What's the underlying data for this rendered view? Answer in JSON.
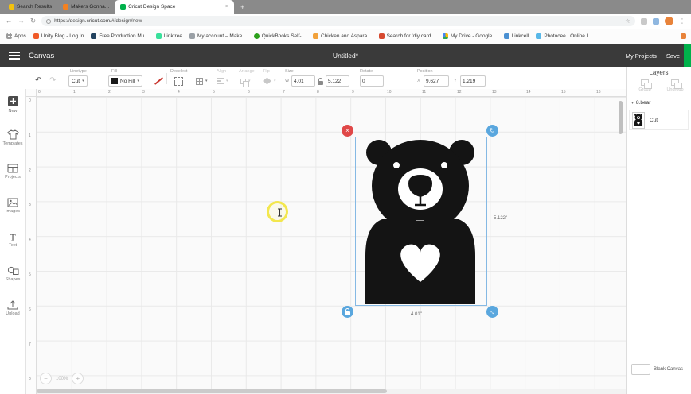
{
  "colors": {
    "cricut_green": "#00b14b",
    "selection_blue": "#5aa7de",
    "delete_handle_red": "#e04848",
    "highlight_yellow": "#f2e43c",
    "header_dark": "#3a3a3a"
  },
  "icons": {
    "back": "←",
    "forward": "→",
    "refresh": "↻",
    "star": "☆",
    "menu": "⋮",
    "close": "×",
    "caret": "▾",
    "undo": "↶",
    "redo": "↷",
    "rotate_handle": "↻",
    "resize_handle": "↔",
    "plus": "+",
    "minus": "−",
    "collapse": "▾",
    "x_mark": "×"
  },
  "browser": {
    "tabs": [
      {
        "label": "Search Results"
      },
      {
        "label": "Makers Gonna..."
      },
      {
        "label": "Cricut Design Space"
      }
    ],
    "url": "https://design.cricut.com/#/design/new",
    "bookmarks": [
      "Apps",
      "Unity Blog - Log In",
      "Free Production Mu...",
      "Linktree",
      "My account – Make...",
      "QuickBooks Self-...",
      "Chicken and Aspara...",
      "Search for 'diy card...",
      "My Drive - Google...",
      "Linkcell",
      "Photocee | Online I..."
    ]
  },
  "header": {
    "canvas": "Canvas",
    "title": "Untitled*",
    "my_projects": "My Projects",
    "save": "Save"
  },
  "toolbar": {
    "linetype": {
      "label": "Linetype",
      "value": "Cut"
    },
    "fill": {
      "label": "Fill",
      "value": "No Fill"
    },
    "deselect": {
      "label": "Deselect"
    },
    "align": {
      "label": "Align"
    },
    "arrange": {
      "label": "Arrange"
    },
    "flip": {
      "label": "Flip"
    },
    "size": {
      "label": "Size",
      "w_label": "W",
      "w": "4.01",
      "h": "5.122"
    },
    "rotate": {
      "label": "Rotate",
      "value": "0"
    },
    "position": {
      "label": "Position",
      "x_label": "X",
      "x": "9.627",
      "y_label": "Y",
      "y": "1.219"
    }
  },
  "sidebar": {
    "items": [
      {
        "label": "New"
      },
      {
        "label": "Templates"
      },
      {
        "label": "Projects"
      },
      {
        "label": "Images"
      },
      {
        "label": "Text"
      },
      {
        "label": "Shapes"
      },
      {
        "label": "Upload"
      }
    ]
  },
  "canvas": {
    "h_ruler": [
      "0",
      "1",
      "2",
      "3",
      "4",
      "5",
      "6",
      "7",
      "8",
      "9",
      "10",
      "11",
      "12",
      "13",
      "14",
      "15",
      "16"
    ],
    "v_ruler": [
      "0",
      "1",
      "2",
      "3",
      "4",
      "5",
      "6",
      "7",
      "8"
    ],
    "selection": {
      "width_label": "4.01\"",
      "height_label": "5.122\""
    }
  },
  "layers": {
    "title": "Layers",
    "group_label": "Group",
    "ungroup_label": "Ungroup",
    "group_name": "8.bear",
    "layer_type": "Cut",
    "blank_canvas": "Blank Canvas"
  },
  "zoom": {
    "value": "100%"
  }
}
